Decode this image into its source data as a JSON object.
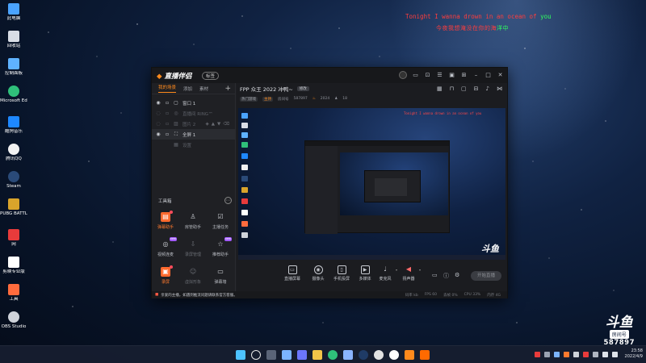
{
  "desktop": {
    "icons": [
      {
        "label": "此电脑",
        "color": "#4aa3ff"
      },
      {
        "label": "回收站",
        "color": "#d8dde6"
      },
      {
        "label": "控制面板",
        "color": "#5fb2ff"
      },
      {
        "label": "Microsoft Edge",
        "color": "#2fc07a"
      },
      {
        "label": "酷狗音乐",
        "color": "#1e88ff"
      },
      {
        "label": "腾讯QQ",
        "color": "#f2f2f2"
      },
      {
        "label": "Steam",
        "color": "#2a4a78"
      },
      {
        "label": "PUBG BATTLEGR...",
        "color": "#d9a42b"
      },
      {
        "label": "网",
        "color": "#e83b3b"
      },
      {
        "label": "剪映专业版",
        "color": "#ffffff"
      },
      {
        "label": "工具",
        "color": "#ff6b3d"
      },
      {
        "label": "OBS Studio",
        "color": "#cfd3da"
      }
    ],
    "lyrics": {
      "line1_red": "Tonight I wanna drown in an ocean of ",
      "line1_green": "you",
      "line2_red": "今夜我想淹没在你的海",
      "line2_green": "洋中"
    }
  },
  "window": {
    "app_name": "直播伴侣",
    "version_badge": "标签",
    "titlebar_icons": [
      "chat",
      "crop",
      "list",
      "shirt",
      "grid",
      "minimize",
      "maximize",
      "close"
    ],
    "left": {
      "tabs": [
        "我的场景",
        "添加",
        "素材"
      ],
      "scenes": [
        {
          "name": "窗口 1",
          "icon": "window"
        },
        {
          "name": "直播间 RING™",
          "icon": "camera"
        },
        {
          "name": "图片 2",
          "icon": "image"
        },
        {
          "name": "全屏 1",
          "icon": "fullscreen"
        },
        {
          "name": "设置",
          "icon": "settings"
        }
      ],
      "toolbox_title": "工具箱",
      "tools": [
        {
          "label": "弹幕助手",
          "highlight": true,
          "badge": "dot"
        },
        {
          "label": "房管助手",
          "highlight": false
        },
        {
          "label": "主播任务",
          "highlight": false
        },
        {
          "label": "视频连麦",
          "highlight": false,
          "badge": "new"
        },
        {
          "label": "录屏管理",
          "highlight": false,
          "dim": true
        },
        {
          "label": "推荐助手",
          "highlight": false,
          "badge": "new"
        },
        {
          "label": "录屏",
          "highlight": true,
          "badge": "dot"
        },
        {
          "label": "虚拟形象",
          "highlight": false,
          "dim": true
        },
        {
          "label": "弹幕墙",
          "highlight": false
        },
        {
          "label": "",
          "highlight": false
        },
        {
          "label": "",
          "highlight": false
        },
        {
          "label": "",
          "highlight": false
        }
      ]
    },
    "main": {
      "stream_title": "FPP 众王 2022 冲鸭~",
      "title_tag": "修改",
      "header_icons": [
        "layout",
        "lock",
        "clip",
        "cast",
        "bell",
        "share"
      ],
      "info_chips": [
        "热门游戏",
        "主持"
      ],
      "room_label": "房间号",
      "room_id": "587897",
      "fire_count": "2024",
      "fan_count": "18",
      "preview": {
        "red_text": "Tonight I wanna drown in an ocean of you",
        "watermark": "斗鱼"
      },
      "bottom_tools": [
        {
          "label": "直播屏幕"
        },
        {
          "label": "摄像头"
        },
        {
          "label": "手机投屏"
        },
        {
          "label": "多媒体"
        },
        {
          "label": "麦克风"
        },
        {
          "label": "扬声器"
        }
      ],
      "live_button": "开始直播"
    },
    "status": {
      "message": "亲爱的主播，如遇到推流问题请联系官方客服。",
      "stats": [
        "码率 kb",
        "FPS 60",
        "丢帧 0%",
        "CPU 33%",
        "内存 4G"
      ]
    }
  },
  "watermark": {
    "brand": "斗鱼",
    "room_label": "房间号",
    "room_number": "587897"
  },
  "taskbar": {
    "apps": [
      "windows",
      "search",
      "taskview",
      "widgets",
      "chat",
      "explorer",
      "edge",
      "store",
      "steam",
      "obs",
      "qq",
      "game",
      "livecompanion"
    ],
    "app_colors": [
      "#4cc2ff",
      "#e6e6e6",
      "#cfcfcf",
      "#7bb4ff",
      "#6b76ff",
      "#f3c448",
      "#2fc07a",
      "#8ab4ff",
      "#1f3b66",
      "#e2e2e2",
      "#ffffff",
      "#ff8a1c",
      "#ff6a00"
    ],
    "time": "23:58",
    "date": "2022/4/9"
  }
}
